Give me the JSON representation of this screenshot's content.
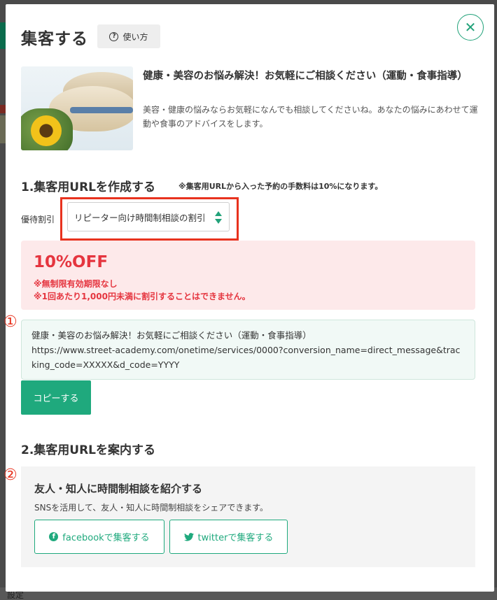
{
  "modal": {
    "title": "集客する",
    "howto_label": "使い方",
    "close_symbol": "✕"
  },
  "course": {
    "title": "健康・美容のお悩み解決！お気軽にご相談ください（運動・食事指導）",
    "description": "美容・健康の悩みならお気軽になんでも相談してくださいね。あなたの悩みにあわせて運動や食事のアドバイスをします。"
  },
  "section1": {
    "heading": "1.集客用URLを作成する",
    "note": "※集客用URLから入った予約の手数料は10%になります。",
    "discount_label": "優待割引",
    "discount_selected": "リピーター向け時間制相談の割引"
  },
  "offer": {
    "title": "10%OFF",
    "line1": "※無制限有効期限なし",
    "line2": "※1回あたり1,000円未満に割引することはできません。"
  },
  "annotations": {
    "marker1": "①",
    "marker2": "②"
  },
  "url_box": {
    "title_line": "健康・美容のお悩み解決！お気軽にご相談ください（運動・食事指導）",
    "url": "https://www.street-academy.com/onetime/services/0000?conversion_name=direct_message&tracking_code=XXXXX&d_code=YYYY"
  },
  "copy_button": "コピーする",
  "section2": {
    "heading": "2.集客用URLを案内する",
    "share_title": "友人・知人に時間制相談を紹介する",
    "share_desc": "SNSを活用して、友人・知人に時間制相談をシェアできます。",
    "facebook_label": "facebookで集客する",
    "twitter_label": "twitterで集客する"
  },
  "background": {
    "bottom_text": "設定"
  },
  "colors": {
    "accent": "#1fa97d",
    "offer_red": "#e5353f",
    "highlight_red": "#e8321e",
    "offer_bg": "#fde9ea"
  },
  "icons": [
    "question-circle-icon",
    "close-icon",
    "select-arrows-icon",
    "facebook-icon",
    "twitter-icon"
  ]
}
